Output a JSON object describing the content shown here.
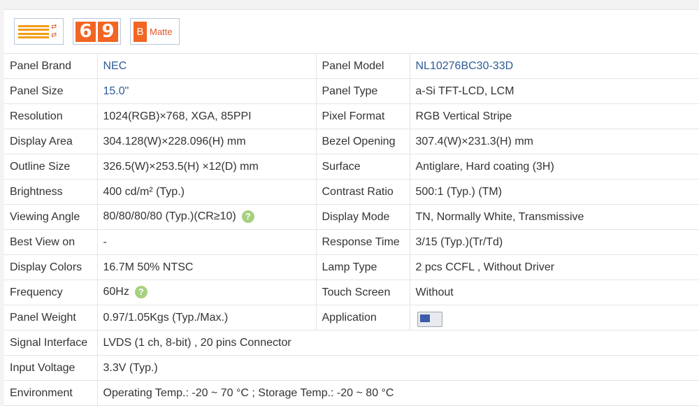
{
  "badges": {
    "number_left": "6",
    "number_right": "9",
    "surface_letter": "B",
    "surface_text": "Matte"
  },
  "rows": [
    {
      "label": "Panel Brand",
      "value": "NEC",
      "label2": "Panel Model",
      "value2": "NL10276BC30-33D"
    },
    {
      "label": "Panel Size",
      "value": "15.0\"",
      "label2": "Panel Type",
      "value2": "a-Si TFT-LCD, LCM"
    },
    {
      "label": "Resolution",
      "value": "1024(RGB)×768, XGA, 85PPI",
      "label2": "Pixel Format",
      "value2": "RGB Vertical Stripe"
    },
    {
      "label": "Display Area",
      "value": "304.128(W)×228.096(H) mm",
      "label2": "Bezel Opening",
      "value2": "307.4(W)×231.3(H) mm"
    },
    {
      "label": "Outline Size",
      "value": "326.5(W)×253.5(H) ×12(D) mm",
      "label2": "Surface",
      "value2": "Antiglare, Hard coating (3H)"
    },
    {
      "label": "Brightness",
      "value": "400 cd/m² (Typ.)",
      "label2": "Contrast Ratio",
      "value2": "500:1 (Typ.) (TM)"
    },
    {
      "label": "Viewing Angle",
      "value": "80/80/80/80 (Typ.)(CR≥10)",
      "label2": "Display Mode",
      "value2": "TN, Normally White, Transmissive"
    },
    {
      "label": "Best View on",
      "value": "-",
      "label2": "Response Time",
      "value2": "3/15 (Typ.)(Tr/Td)"
    },
    {
      "label": "Display Colors",
      "value": "16.7M   50% NTSC",
      "label2": "Lamp Type",
      "value2": "2 pcs CCFL , Without Driver"
    },
    {
      "label": "Frequency",
      "value": "60Hz",
      "label2": "Touch Screen",
      "value2": "Without"
    },
    {
      "label": "Panel Weight",
      "value": "0.97/1.05Kgs (Typ./Max.)",
      "label2": "Application",
      "value2": ""
    },
    {
      "label": "Signal Interface",
      "value": "LVDS (1 ch, 8-bit) , 20 pins Connector"
    },
    {
      "label": "Input Voltage",
      "value": "3.3V (Typ.)"
    },
    {
      "label": "Environment",
      "value": "Operating Temp.: -20 ~ 70 °C ; Storage Temp.: -20 ~ 80 °C"
    }
  ],
  "help_icon": "?",
  "icons": {
    "application": "monitor-device-icon",
    "help": "question-icon",
    "badge": "brightness-bars-icon"
  },
  "colors": {
    "link_blue": "#2e5b96",
    "orange": "#f26522",
    "help_green": "#a6d07e"
  }
}
